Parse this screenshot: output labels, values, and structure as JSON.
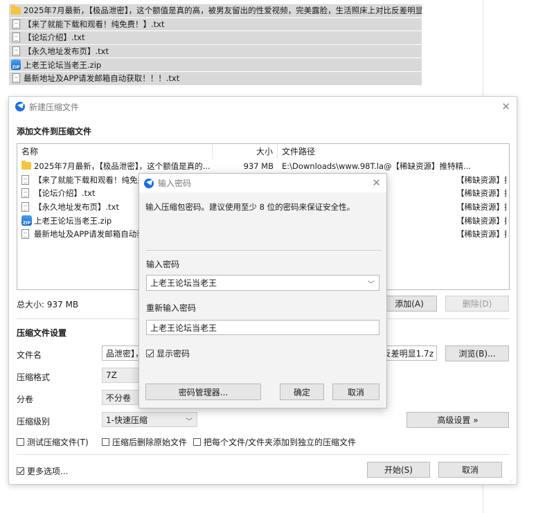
{
  "explorer": {
    "items": [
      {
        "icon": "folder-icon",
        "name": "2025年7月最新，【极品泄密】，这个额值是真的高，被男友留出的性爱视频，完美露脸，生活照床上对比反差明显"
      },
      {
        "icon": "text-file-icon",
        "name": "【来了就能下载和观看！纯免费！】.txt"
      },
      {
        "icon": "text-file-icon",
        "name": "【论坛介绍】.txt"
      },
      {
        "icon": "text-file-icon",
        "name": "【永久地址发布页】.txt"
      },
      {
        "icon": "zip-file-icon",
        "name": "上老王论坛当老王.zip"
      },
      {
        "icon": "text-file-icon",
        "name": "最新地址及APP请发邮箱自动获取！！！.txt"
      }
    ]
  },
  "main_dialog": {
    "title": "新建压缩文件",
    "section_add": "添加文件到压缩文件",
    "columns": {
      "name": "名称",
      "size": "大小",
      "path": "文件路径"
    },
    "rows": [
      {
        "icon": "folder-icon",
        "name": "2025年7月最新，【极品泄密】，这个额值是真的...",
        "size": "937 MB",
        "path": "E:\\Downloads\\www.98T.la@【稀缺资源】推特精..."
      },
      {
        "icon": "text-file-icon",
        "name": "【来了就能下载和观看！纯免费",
        "size": "",
        "path": "【稀缺资源】推特精..."
      },
      {
        "icon": "text-file-icon",
        "name": "【论坛介绍】.txt",
        "size": "",
        "path": "【稀缺资源】推特精..."
      },
      {
        "icon": "text-file-icon",
        "name": "【永久地址发布页】.txt",
        "size": "",
        "path": "【稀缺资源】推特精..."
      },
      {
        "icon": "zip-file-icon",
        "name": "上老王论坛当老王.zip",
        "size": "",
        "path": "【稀缺资源】推特精..."
      },
      {
        "icon": "text-file-icon",
        "name": "最新地址及APP请发邮箱自动获",
        "size": "",
        "path": "【稀缺资源】推特精..."
      }
    ],
    "total_size": "总大小: 937 MB",
    "add_button": "添加(A)",
    "delete_button": "删除(D)",
    "section_settings": "压缩文件设置",
    "filename_label": "文件名",
    "filename_value_left": "品泄密】，",
    "filename_value_right": "反差明显1.7z",
    "browse_button": "浏览(B)...",
    "format_label": "压缩格式",
    "format_value": "7Z",
    "volume_label": "分卷",
    "volume_value": "不分卷",
    "level_label": "压缩级别",
    "level_value": "1-快速压缩",
    "advanced_button": "高级设置 »",
    "opt_test": "测试压缩文件(T)",
    "opt_delete": "压缩后删除原始文件",
    "opt_separate": "把每个文件/文件夹添加到独立的压缩文件",
    "more_options": "更多选项...",
    "start_button": "开始(S)",
    "cancel_button": "取消"
  },
  "password_dialog": {
    "title": "输入密码",
    "hint": "输入压缩包密码。建议使用至少 8 位的密码来保证安全性。",
    "password_label": "输入密码",
    "password_value": "上老王论坛当老王",
    "confirm_label": "重新输入密码",
    "confirm_value": "上老王论坛当老王",
    "show_password": "显示密码",
    "show_password_checked": true,
    "manager_button": "密码管理器...",
    "ok_button": "确定",
    "cancel_button": "取消"
  }
}
